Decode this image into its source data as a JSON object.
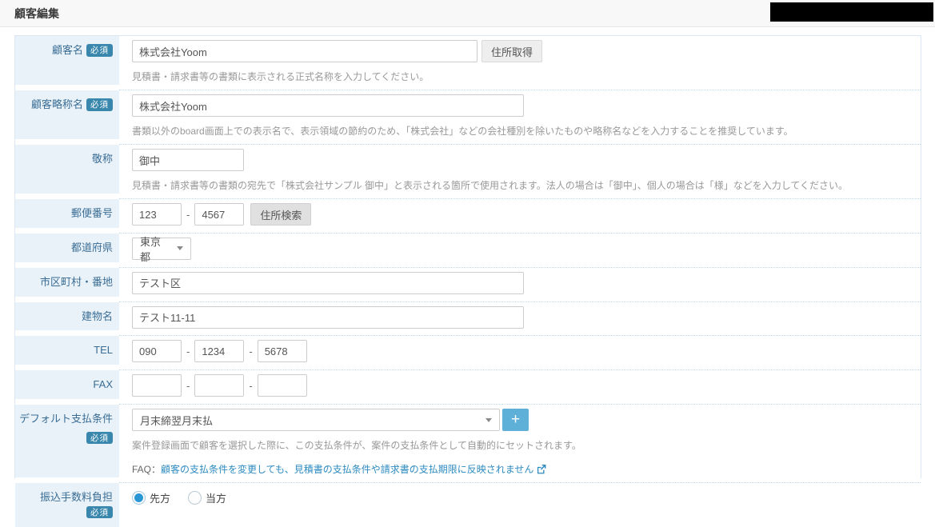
{
  "page": {
    "title": "顧客編集"
  },
  "colors": {
    "required_badge_bg": "#3a87ad",
    "label_column_bg": "#e9f2f9",
    "label_text": "#3a6d95",
    "link": "#2e8bc0",
    "add_button_bg": "#5eb0d9",
    "radio_selected": "#2a97d4"
  },
  "fields": {
    "customer_name": {
      "label": "顧客名",
      "required": "必須",
      "value": "株式会社Yoom",
      "button": "住所取得",
      "help": "見積書・請求書等の書類に表示される正式名称を入力してください。"
    },
    "customer_short_name": {
      "label": "顧客略称名",
      "required": "必須",
      "value": "株式会社Yoom",
      "help": "書類以外のboard画面上での表示名で、表示領域の節約のため、「株式会社」などの会社種別を除いたものや略称名などを入力することを推奨しています。"
    },
    "honorific": {
      "label": "敬称",
      "value": "御中",
      "help": "見積書・請求書等の書類の宛先で「株式会社サンプル 御中」と表示される箇所で使用されます。法人の場合は「御中」、個人の場合は「様」などを入力してください。"
    },
    "postal_code": {
      "label": "郵便番号",
      "value1": "123",
      "value2": "4567",
      "separator": "-",
      "button": "住所検索"
    },
    "prefecture": {
      "label": "都道府県",
      "value": "東京都"
    },
    "city": {
      "label": "市区町村・番地",
      "value": "テスト区"
    },
    "building": {
      "label": "建物名",
      "value": "テスト11-11"
    },
    "tel": {
      "label": "TEL",
      "value1": "090",
      "value2": "1234",
      "value3": "5678",
      "separator": "-"
    },
    "fax": {
      "label": "FAX",
      "value1": "",
      "value2": "",
      "value3": "",
      "separator": "-"
    },
    "payment_terms": {
      "label": "デフォルト支払条件",
      "required": "必須",
      "value": "月末締翌月末払",
      "add_button": "+",
      "help": "案件登録画面で顧客を選択した際に、この支払条件が、案件の支払条件として自動的にセットされます。",
      "faq_prefix": "FAQ：",
      "faq_link_text": "顧客の支払条件を変更しても、見積書の支払条件や請求書の支払期限に反映されません"
    },
    "transfer_fee": {
      "label": "振込手数料負担",
      "required": "必須",
      "options": [
        {
          "label": "先方",
          "selected": true
        },
        {
          "label": "当方",
          "selected": false
        }
      ]
    }
  }
}
